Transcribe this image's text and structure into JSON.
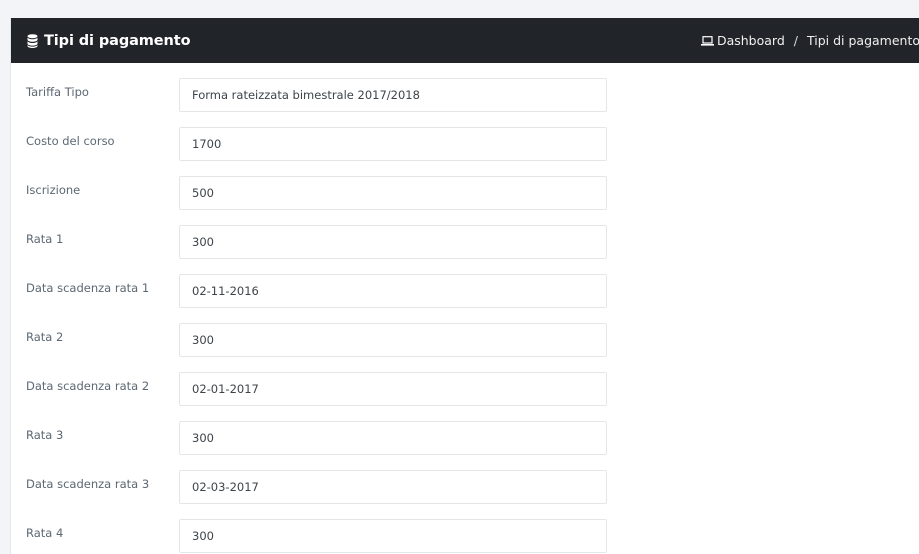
{
  "header": {
    "title": "Tipi di pagamento",
    "title_icon": "database-icon",
    "breadcrumb": {
      "icon": "laptop-icon",
      "home_label": "Dashboard",
      "separator": "/",
      "current_label": "Tipi di pagamento"
    }
  },
  "form": {
    "fields": [
      {
        "label": "Tariffa Tipo",
        "value": "Forma rateizzata bimestrale 2017/2018"
      },
      {
        "label": "Costo del corso",
        "value": "1700"
      },
      {
        "label": "Iscrizione",
        "value": "500"
      },
      {
        "label": "Rata 1",
        "value": "300"
      },
      {
        "label": "Data scadenza rata 1",
        "value": "02-11-2016"
      },
      {
        "label": "Rata 2",
        "value": "300"
      },
      {
        "label": "Data scadenza rata 2",
        "value": "02-01-2017"
      },
      {
        "label": "Rata 3",
        "value": "300"
      },
      {
        "label": "Data scadenza rata 3",
        "value": "02-03-2017"
      },
      {
        "label": "Rata 4",
        "value": "300"
      }
    ]
  },
  "colors": {
    "header_bg": "#212529",
    "page_bg": "#f3f4f8",
    "label_text": "#5c6873",
    "input_border": "#e4e7ea"
  }
}
